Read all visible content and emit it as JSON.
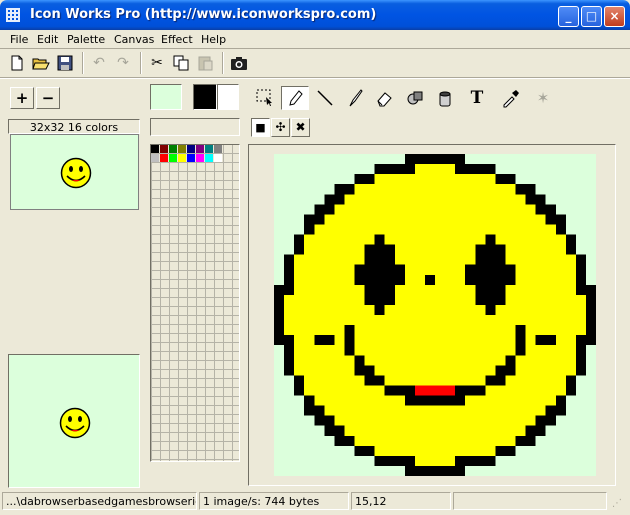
{
  "window": {
    "title": "Icon Works Pro (http://www.iconworkspro.com)"
  },
  "menu": [
    "File",
    "Edit",
    "Palette",
    "Canvas",
    "Effect",
    "Help"
  ],
  "toolbar": {
    "new": "new-icon",
    "open": "open-icon",
    "save": "save-icon",
    "undo": "undo-icon",
    "redo": "redo-icon",
    "cut": "cut-icon",
    "copy": "copy-icon",
    "paste": "paste-icon",
    "capture": "camera-icon"
  },
  "left_panel": {
    "add_label": "+",
    "remove_label": "−",
    "format_label": "32x32 16 colors"
  },
  "palette": {
    "swatch_light": "#dcffdc",
    "fg": "#000000",
    "bg": "#ffffff",
    "colors": [
      "#000000",
      "#800000",
      "#008000",
      "#808000",
      "#000080",
      "#800080",
      "#008080",
      "#808080",
      "#c0c0c0",
      "#ff0000",
      "#00ff00",
      "#ffff00",
      "#0000ff",
      "#ff00ff",
      "#00ffff",
      "#ffffff"
    ]
  },
  "tools": [
    "select",
    "pencil",
    "line",
    "brush",
    "eraser",
    "fill",
    "bucket",
    "text",
    "picker",
    "magic"
  ],
  "brush_shapes": [
    "square",
    "dots",
    "cross"
  ],
  "canvas": {
    "background": "#dcffdc",
    "face": "#ffff00",
    "outline": "#000000",
    "mouth": "#ff0000"
  },
  "status": {
    "file": "...\\dabrowserbasedgamesbrowsericon",
    "images": "1 image/s: 744 bytes",
    "coords": "15,12",
    "extra": ""
  }
}
